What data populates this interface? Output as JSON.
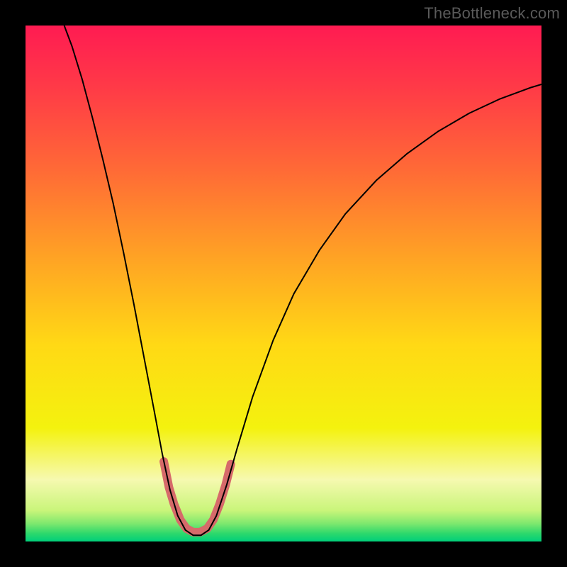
{
  "watermark": "TheBottleneck.com",
  "chart_data": {
    "type": "line",
    "title": "",
    "xlabel": "",
    "ylabel": "",
    "xlim": [
      0,
      1
    ],
    "ylim": [
      0,
      1
    ],
    "background_gradient": {
      "stops": [
        {
          "pos": 0.0,
          "color": "#ff1b52"
        },
        {
          "pos": 0.12,
          "color": "#ff3a47"
        },
        {
          "pos": 0.28,
          "color": "#ff6a36"
        },
        {
          "pos": 0.45,
          "color": "#ffa324"
        },
        {
          "pos": 0.62,
          "color": "#ffd915"
        },
        {
          "pos": 0.78,
          "color": "#f4f20e"
        },
        {
          "pos": 0.88,
          "color": "#f6f9b0"
        },
        {
          "pos": 0.94,
          "color": "#c9f57a"
        },
        {
          "pos": 0.965,
          "color": "#7fe86e"
        },
        {
          "pos": 0.985,
          "color": "#2bd86c"
        },
        {
          "pos": 1.0,
          "color": "#00cf7a"
        }
      ]
    },
    "series": [
      {
        "name": "bottleneck-curve",
        "stroke": "#000000",
        "stroke_width": 2,
        "points": [
          {
            "x": 0.075,
            "y": 1.0
          },
          {
            "x": 0.09,
            "y": 0.96
          },
          {
            "x": 0.11,
            "y": 0.895
          },
          {
            "x": 0.13,
            "y": 0.82
          },
          {
            "x": 0.15,
            "y": 0.74
          },
          {
            "x": 0.17,
            "y": 0.655
          },
          {
            "x": 0.19,
            "y": 0.56
          },
          {
            "x": 0.21,
            "y": 0.46
          },
          {
            "x": 0.23,
            "y": 0.355
          },
          {
            "x": 0.25,
            "y": 0.25
          },
          {
            "x": 0.265,
            "y": 0.17
          },
          {
            "x": 0.28,
            "y": 0.1
          },
          {
            "x": 0.295,
            "y": 0.05
          },
          {
            "x": 0.31,
            "y": 0.022
          },
          {
            "x": 0.325,
            "y": 0.012
          },
          {
            "x": 0.34,
            "y": 0.012
          },
          {
            "x": 0.355,
            "y": 0.022
          },
          {
            "x": 0.37,
            "y": 0.05
          },
          {
            "x": 0.39,
            "y": 0.11
          },
          {
            "x": 0.41,
            "y": 0.18
          },
          {
            "x": 0.44,
            "y": 0.28
          },
          {
            "x": 0.48,
            "y": 0.39
          },
          {
            "x": 0.52,
            "y": 0.48
          },
          {
            "x": 0.57,
            "y": 0.565
          },
          {
            "x": 0.62,
            "y": 0.635
          },
          {
            "x": 0.68,
            "y": 0.7
          },
          {
            "x": 0.74,
            "y": 0.752
          },
          {
            "x": 0.8,
            "y": 0.795
          },
          {
            "x": 0.86,
            "y": 0.83
          },
          {
            "x": 0.92,
            "y": 0.858
          },
          {
            "x": 0.98,
            "y": 0.88
          },
          {
            "x": 1.0,
            "y": 0.886
          }
        ]
      },
      {
        "name": "highlight-band",
        "stroke": "#d66a6a",
        "stroke_width": 12,
        "linecap": "round",
        "points": [
          {
            "x": 0.268,
            "y": 0.155
          },
          {
            "x": 0.278,
            "y": 0.105
          },
          {
            "x": 0.288,
            "y": 0.072
          },
          {
            "x": 0.3,
            "y": 0.042
          },
          {
            "x": 0.312,
            "y": 0.025
          },
          {
            "x": 0.325,
            "y": 0.018
          },
          {
            "x": 0.338,
            "y": 0.018
          },
          {
            "x": 0.352,
            "y": 0.025
          },
          {
            "x": 0.364,
            "y": 0.042
          },
          {
            "x": 0.376,
            "y": 0.072
          },
          {
            "x": 0.388,
            "y": 0.11
          },
          {
            "x": 0.398,
            "y": 0.15
          }
        ]
      }
    ]
  }
}
